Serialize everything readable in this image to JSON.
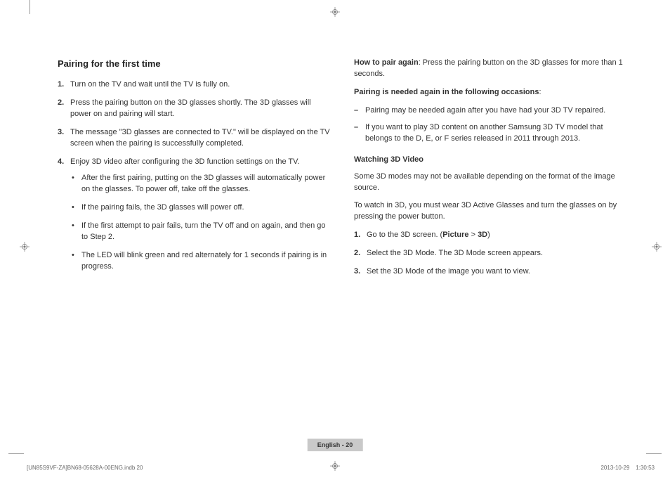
{
  "left": {
    "heading": "Pairing for the first time",
    "steps": [
      "Turn on the TV and wait until the TV is fully on.",
      "Press the pairing button on the 3D glasses shortly. The 3D glasses will power on and pairing will start.",
      "The message \"3D glasses are connected to TV.\" will be displayed on the TV screen when the pairing is successfully completed.",
      "Enjoy 3D video after configuring the 3D function settings on the TV."
    ],
    "bullets": [
      "After the first pairing, putting on the 3D glasses will automatically power on the glasses. To power off, take off the glasses.",
      "If the pairing fails, the 3D glasses will power off.",
      "If the first attempt to pair fails, turn the TV off and on again, and then go to Step 2.",
      "The LED will blink green and red alternately for 1 seconds if pairing is in progress."
    ]
  },
  "right": {
    "how_to_pair_label": "How to pair again",
    "how_to_pair_text": ": Press the pairing button on the 3D glasses for more than 1 seconds.",
    "pairing_needed_label": "Pairing is needed again in the following occasions",
    "pairing_needed_colon": ":",
    "dash_items": [
      "Pairing may be needed again after you have had your 3D TV repaired.",
      "If you want to play 3D content on another Samsung 3D TV model that belongs to the D, E, or F series released in 2011 through 2013."
    ],
    "watching_heading": "Watching 3D Video",
    "watching_p1": "Some 3D modes may not be available depending on the format of the image source.",
    "watching_p2": "To watch in 3D, you must wear 3D Active Glasses and turn the glasses on by pressing the power button.",
    "watch_steps": {
      "s1_pre": "Go to the 3D screen. (",
      "s1_b1": "Picture",
      "s1_mid": " > ",
      "s1_b2": "3D",
      "s1_post": ")",
      "s2": "Select the 3D Mode. The 3D Mode screen appears.",
      "s3": "Set the 3D Mode of the image you want to view."
    }
  },
  "page_label": "English - 20",
  "footer": {
    "left": "[UN85S9VF-ZA]BN68-05628A-00ENG.indb   20",
    "right": "2013-10-29      1:30:53"
  }
}
